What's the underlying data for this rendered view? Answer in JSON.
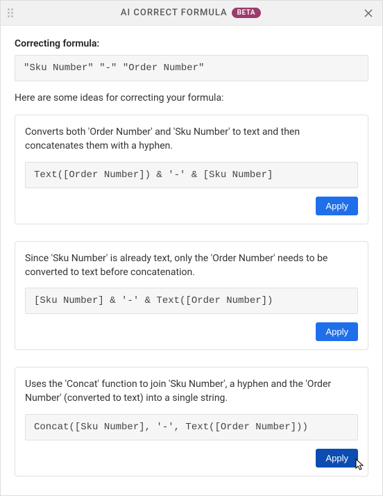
{
  "header": {
    "title": "AI CORRECT FORMULA",
    "badge": "BETA"
  },
  "section": {
    "label": "Correcting formula:",
    "original_formula": "\"Sku Number\" \"-\" \"Order Number\"",
    "intro": "Here are some ideas for correcting your formula:"
  },
  "apply_label": "Apply",
  "suggestions": [
    {
      "description": "Converts both 'Order Number' and 'Sku Number' to text and then concatenates them with a hyphen.",
      "formula": "Text([Order Number]) & '-' & [Sku Number]"
    },
    {
      "description": "Since 'Sku Number' is already text, only the 'Order Number' needs to be converted to text before concatenation.",
      "formula": "[Sku Number] & '-' & Text([Order Number])"
    },
    {
      "description": "Uses the 'Concat' function to join 'Sku Number', a hyphen and the 'Order Number' (converted to text) into a single string.",
      "formula": "Concat([Sku Number], '-', Text([Order Number]))"
    }
  ]
}
